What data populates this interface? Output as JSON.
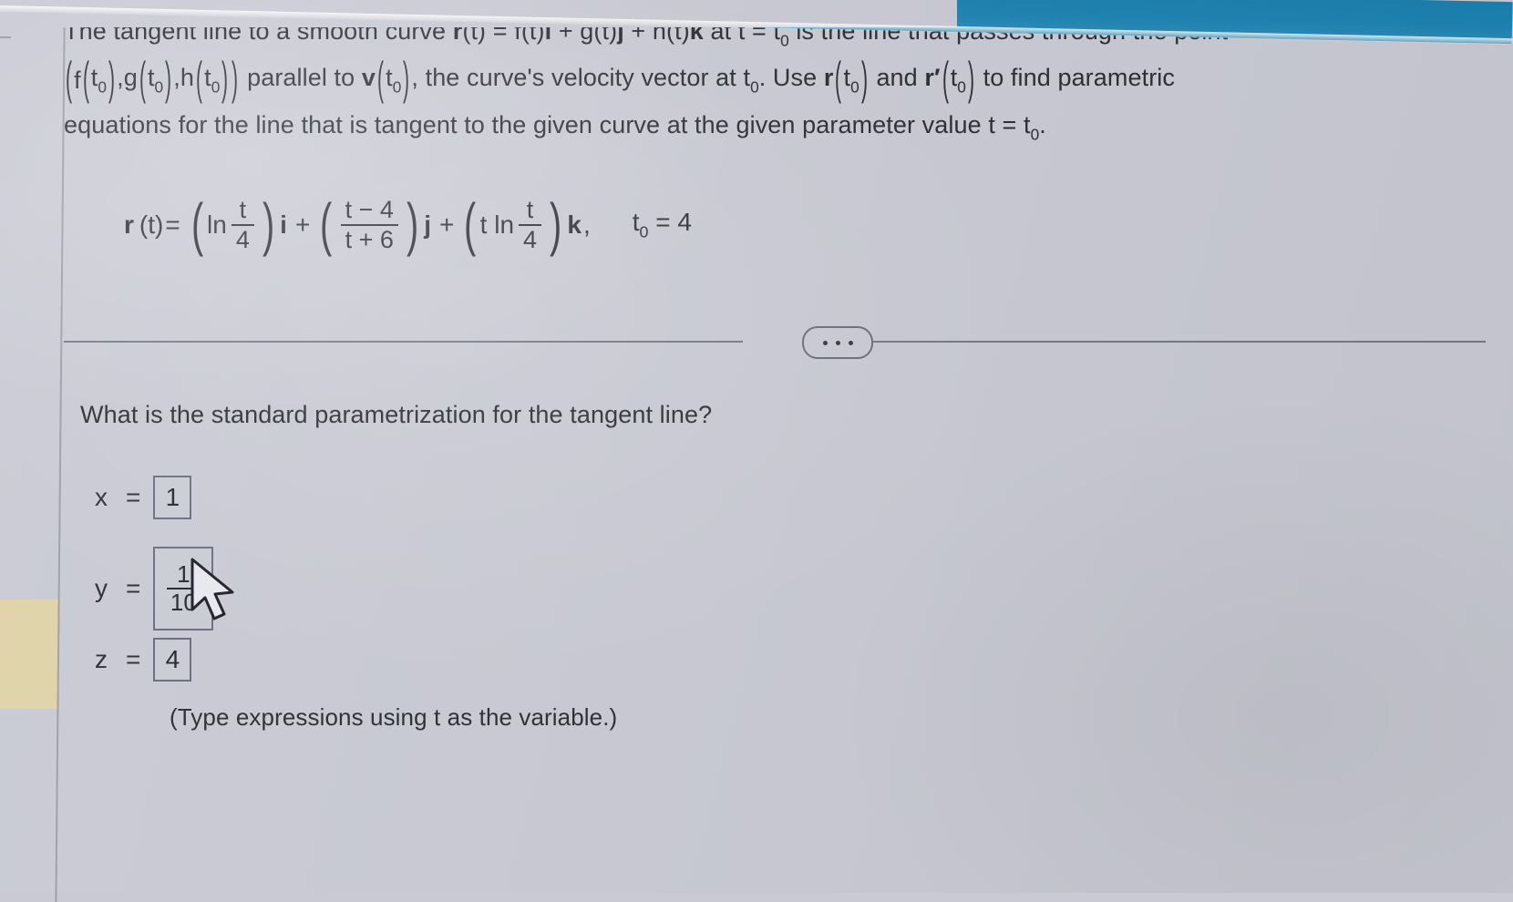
{
  "colors": {
    "page_background": "#c9cad4",
    "text": "#2b2b33",
    "top_band": "#1b82b2",
    "left_block": "#e0d3a8",
    "box_border": "#6b6b80"
  },
  "prompt": {
    "line1_a": "The tangent line to a smooth curve ",
    "line1_r": "r",
    "line1_b": "(t) = f(t)",
    "line1_i": "i",
    "line1_c": " + g(t)",
    "line1_j": "j",
    "line1_d": " + h(t)",
    "line1_k": "k",
    "line1_e": " at t = t",
    "line1_sub": "0",
    "line1_f": " is the line that passes through the point",
    "line2_f": "f",
    "line2_t0a": "t",
    "line2_sub_a": "0",
    "line2_comma1": ",",
    "line2_g": "g",
    "line2_t0b": "t",
    "line2_sub_b": "0",
    "line2_comma2": ",",
    "line2_h": "h",
    "line2_t0c": "t",
    "line2_sub_c": "0",
    "line2_parallel": " parallel to ",
    "line2_v": "v",
    "line2_t0d": "t",
    "line2_sub_d": "0",
    "line2_rest": ", the curve's velocity vector at t",
    "line2_sub_e": "0",
    "line2_use": ". Use ",
    "line2_r": "r",
    "line2_t0e": "t",
    "line2_sub_f": "0",
    "line2_and": " and ",
    "line2_rprime": "r′",
    "line2_t0f": "t",
    "line2_sub_g": "0",
    "line2_tofind": " to find parametric",
    "line3_a": "equations for the line that is tangent to the given curve at the given parameter value t = t",
    "line3_sub": "0",
    "line3_b": "."
  },
  "equation": {
    "lead": "r",
    "lead_arg": "(t)",
    "equals": "=",
    "ln": "ln",
    "term1_num": "t",
    "term1_den": "4",
    "i": "i",
    "plus1": "+",
    "term2_num": "t − 4",
    "term2_den": "t + 6",
    "j": "j",
    "plus2": "+",
    "term3_lead": "t ln",
    "term3_num": "t",
    "term3_den": "4",
    "k": "k",
    "comma": ",",
    "t0_label": "t",
    "t0_sub": "0",
    "t0_value": "= 4"
  },
  "divider": {
    "more_icon": "ellipsis-horizontal-icon"
  },
  "question": {
    "text": "What is the standard parametrization for the tangent line?"
  },
  "answers": {
    "x": {
      "label": "x",
      "equals": "=",
      "value": "1"
    },
    "y": {
      "label": "y",
      "equals": "=",
      "value_numerator": "1",
      "value_denominator": "10"
    },
    "z": {
      "label": "z",
      "equals": "=",
      "value": "4"
    }
  },
  "hint": {
    "text": "(Type expressions using t as the variable.)"
  },
  "cursor": {
    "icon": "mouse-pointer-icon"
  }
}
